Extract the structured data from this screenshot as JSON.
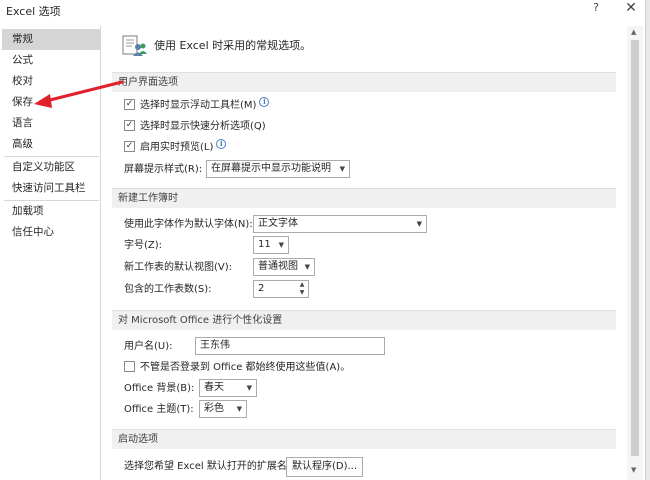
{
  "window": {
    "title": "Excel 选项",
    "help_label": "?",
    "close_label": "✕"
  },
  "sidebar": {
    "items": [
      {
        "label": "常规",
        "active": true
      },
      {
        "label": "公式"
      },
      {
        "label": "校对"
      },
      {
        "label": "保存"
      },
      {
        "label": "语言"
      },
      {
        "label": "高级"
      },
      {
        "label": "自定义功能区"
      },
      {
        "label": "快速访问工具栏"
      },
      {
        "label": "加载项"
      },
      {
        "label": "信任中心"
      }
    ]
  },
  "annotation": {
    "color": "#e0202a"
  },
  "header": {
    "text": "使用 Excel 时采用的常规选项。",
    "icon": "general-options-icon"
  },
  "ui_options": {
    "section_title": "用户界面选项",
    "mini_toolbar": {
      "label": "选择时显示浮动工具栏(M)",
      "checked": true
    },
    "quick_analysis": {
      "label": "选择时显示快速分析选项(Q)",
      "checked": true
    },
    "live_preview": {
      "label": "启用实时预览(L)",
      "checked": true
    },
    "screentip_label": "屏幕提示样式(R):",
    "screentip_value": "在屏幕提示中显示功能说明"
  },
  "new_workbook": {
    "section_title": "新建工作簿时",
    "font_label": "使用此字体作为默认字体(N):",
    "font_value": "正文字体",
    "size_label": "字号(Z):",
    "size_value": "11",
    "view_label": "新工作表的默认视图(V):",
    "view_value": "普通视图",
    "sheets_label": "包含的工作表数(S):",
    "sheets_value": "2"
  },
  "personalize": {
    "section_title": "对 Microsoft Office 进行个性化设置",
    "username_label": "用户名(U):",
    "username_value": "王东伟",
    "always_use": {
      "label": "不管是否登录到 Office 都始终使用这些值(A)。",
      "checked": false
    },
    "background_label": "Office 背景(B):",
    "background_value": "春天",
    "theme_label": "Office 主题(T):",
    "theme_value": "彩色"
  },
  "startup": {
    "section_title": "启动选项",
    "ext_label": "选择您希望 Excel 默认打开的扩展名:",
    "default_programs_button": "默认程序(D)..."
  },
  "glyphs": {
    "check": "✓",
    "info": "i",
    "dropdown": "▼",
    "spin_up": "▲",
    "spin_down": "▼",
    "scroll_up": "▲",
    "scroll_down": "▼"
  }
}
